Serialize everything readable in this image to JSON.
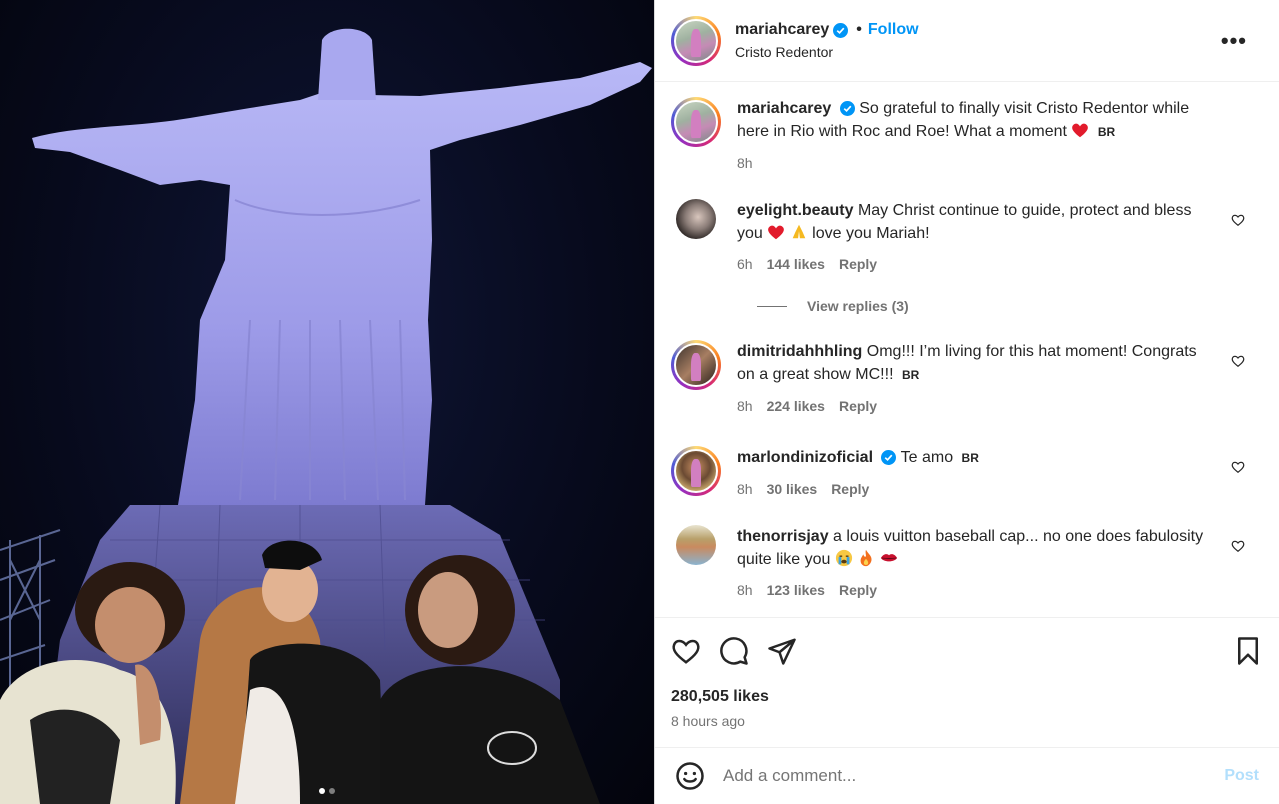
{
  "post": {
    "username": "mariahcarey",
    "follow_label": "Follow",
    "separator": "•",
    "location": "Cristo Redentor",
    "more_label": "•••",
    "caption": "So grateful to finally visit Cristo Redentor while here in Rio with Roc and Roe! What a moment",
    "caption_tag": "BR",
    "caption_time": "8h",
    "likes": "280,505 likes",
    "time_ago": "8 hours ago"
  },
  "comments": [
    {
      "username": "eyelight.beauty",
      "text_before": "May Christ continue to guide, protect and bless you",
      "text_after": "love you Mariah!",
      "time": "6h",
      "likes": "144 likes",
      "reply": "Reply"
    },
    {
      "username": "dimitridahhhling",
      "text": "Omg!!! I’m living for this hat moment! Congrats on a great show MC!!!",
      "tag": "BR",
      "time": "8h",
      "likes": "224 likes",
      "reply": "Reply"
    },
    {
      "username": "marlondinizoficial",
      "text": "Te amo",
      "tag": "BR",
      "time": "8h",
      "likes": "30 likes",
      "reply": "Reply"
    },
    {
      "username": "thenorrisjay",
      "text": "a louis vuitton baseball cap... no one does fabulosity quite like you",
      "time": "8h",
      "likes": "123 likes",
      "reply": "Reply"
    }
  ],
  "view_replies": "View replies (3)",
  "add_comment": {
    "placeholder": "Add a comment...",
    "post_label": "Post"
  },
  "colors": {
    "link_blue": "#0095f6",
    "post_disabled": "#b2dffc",
    "muted": "#737373",
    "text": "#262626"
  },
  "icons": [
    "verified-badge-icon",
    "more-options-icon",
    "heart-icon",
    "comment-icon",
    "share-icon",
    "bookmark-icon",
    "emoji-icon"
  ]
}
